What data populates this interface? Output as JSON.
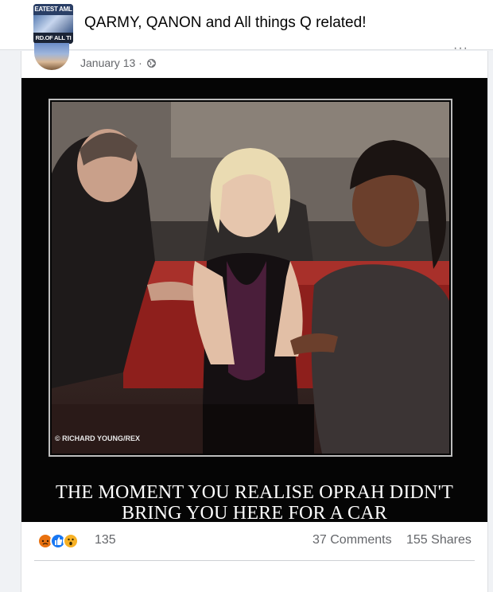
{
  "group": {
    "name": "QARMY, QANON and All things Q related!",
    "avatar_text_top": "EATEST AML",
    "avatar_text_bottom": "RD.OF ALL TI"
  },
  "post": {
    "date": "January 13",
    "date_separator": "·",
    "more_label": "···",
    "image": {
      "photo_credit": "© RICHARD YOUNG/REX",
      "caption_line1": "THE MOMENT YOU REALISE OPRAH DIDN'T",
      "caption_line2": "BRING YOU HERE FOR A CAR"
    },
    "stats": {
      "reaction_count": "135",
      "comments": "37 Comments",
      "shares": "155 Shares"
    },
    "reaction_icons": [
      "angry-icon",
      "like-icon",
      "wow-icon"
    ]
  }
}
